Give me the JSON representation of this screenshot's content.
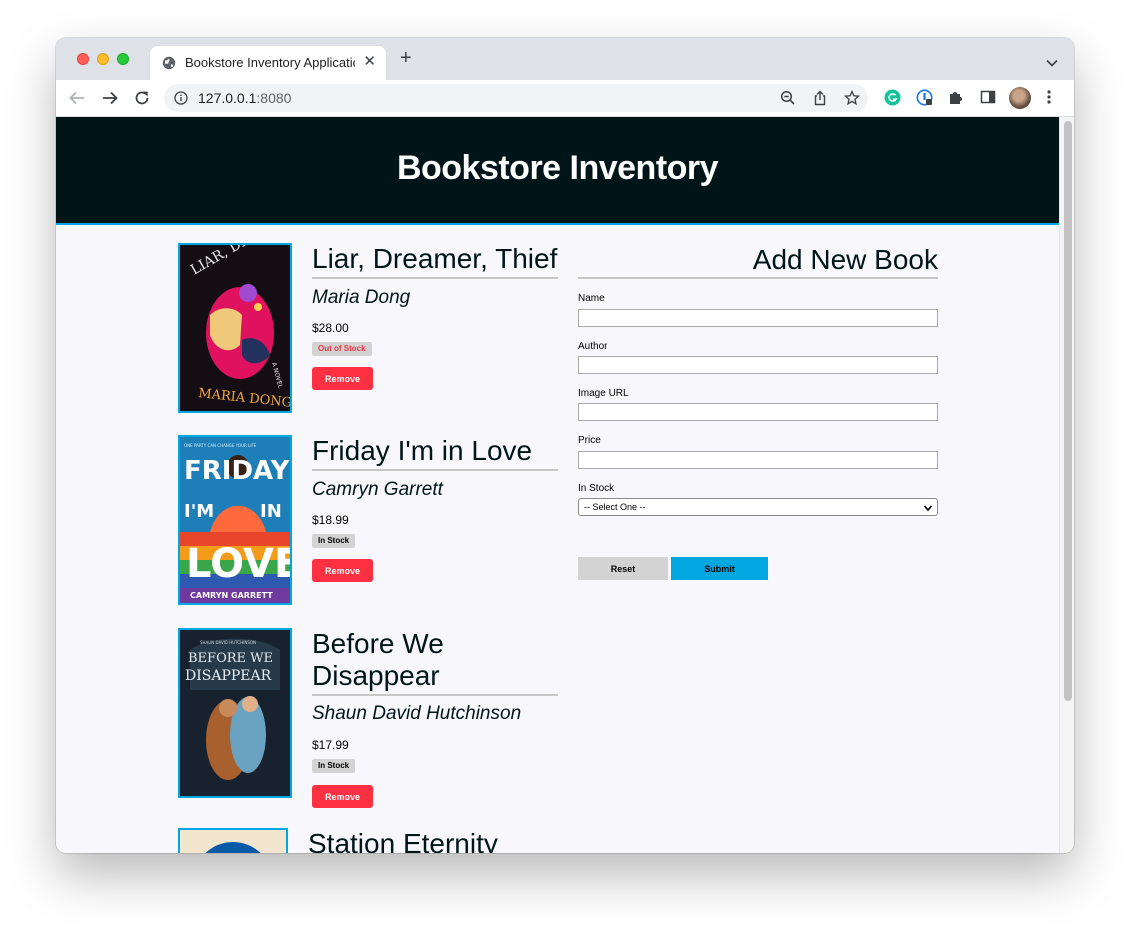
{
  "browser": {
    "tab_title": "Bookstore Inventory Application",
    "url_host": "127.0.0.1",
    "url_port": ":8080"
  },
  "page": {
    "heading": "Bookstore Inventory"
  },
  "books": [
    {
      "title": "Liar, Dreamer, Thief",
      "author": "Maria Dong",
      "price": "$28.00",
      "stock": "Out of Stock",
      "remove_label": "Remove",
      "cover_text": [
        "LIAR, DREAMER, THIEF",
        "A NOVEL",
        "MARIA DONG"
      ],
      "cover_color": "#e0115f"
    },
    {
      "title": "Friday I'm in Love",
      "author": "Camryn Garrett",
      "price": "$18.99",
      "stock": "In Stock",
      "remove_label": "Remove",
      "cover_text": [
        "ONE PARTY CAN CHANGE YOUR LIFE",
        "FRIDAY",
        "I'M",
        "IN",
        "LOVE",
        "CAMRYN GARRETT"
      ],
      "cover_color": "#1e7fb8"
    },
    {
      "title": "Before We Disappear",
      "author": "Shaun David Hutchinson",
      "price": "$17.99",
      "stock": "In Stock",
      "remove_label": "Remove",
      "cover_text": [
        "SHAUN DAVID HUTCHINSON",
        "BEFORE WE",
        "DISAPPEAR"
      ],
      "cover_color": "#1c2a38"
    },
    {
      "title": "Station Eternity"
    }
  ],
  "form": {
    "title": "Add New Book",
    "name_label": "Name",
    "author_label": "Author",
    "image_label": "Image URL",
    "price_label": "Price",
    "stock_label": "In Stock",
    "stock_selected": "-- Select One --",
    "reset_label": "Reset",
    "submit_label": "Submit"
  },
  "colors": {
    "header_bg": "#001518",
    "accent": "#00a7e1",
    "remove_button": "#ff3041",
    "out_of_stock_text": "#ee3344"
  }
}
